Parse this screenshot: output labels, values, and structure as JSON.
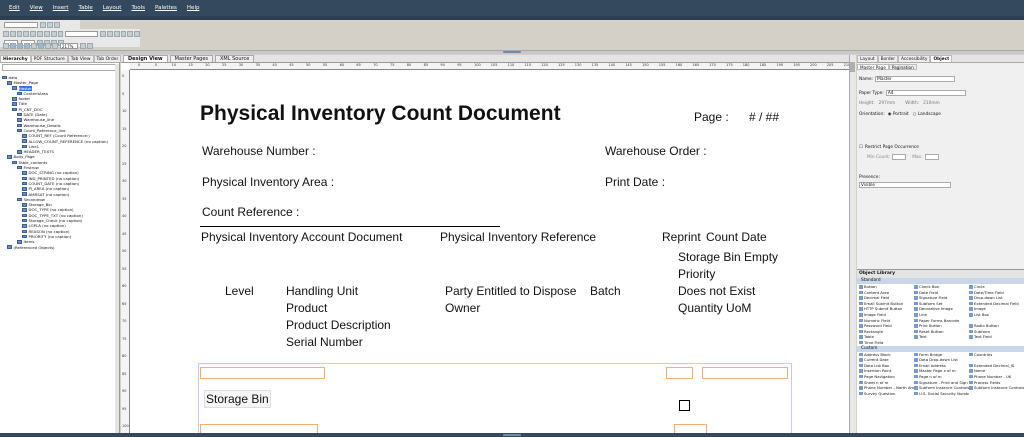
{
  "menu": [
    "Edit",
    "View",
    "Insert",
    "Table",
    "Layout",
    "Tools",
    "Palettes",
    "Help"
  ],
  "toolbar": {
    "zoom": "217%"
  },
  "left_panel": {
    "tabs": [
      "Hierarchy",
      "PDF Structure",
      "Tab View",
      "Tab Order"
    ],
    "tree": [
      {
        "label": "data",
        "indent": 0
      },
      {
        "label": "Master_Page",
        "indent": 1
      },
      {
        "label": "Master",
        "indent": 2,
        "selected": true
      },
      {
        "label": "ContentArea",
        "indent": 3
      },
      {
        "label": "footer",
        "indent": 2
      },
      {
        "label": "Title",
        "indent": 2
      },
      {
        "label": "PI_CNT_DOC",
        "indent": 2
      },
      {
        "label": "DATE (Date)",
        "indent": 3
      },
      {
        "label": "Warehouse_line",
        "indent": 3
      },
      {
        "label": "Warehouse_Details",
        "indent": 3
      },
      {
        "label": "Count_Reference_line",
        "indent": 3
      },
      {
        "label": "COUNT_REF (Count Reference:)",
        "indent": 4
      },
      {
        "label": "ALLOW_COUNT_REFERENCE (no caption)",
        "indent": 4
      },
      {
        "label": "Line1",
        "indent": 4
      },
      {
        "label": "HEADER_TEXTS",
        "indent": 3
      },
      {
        "label": "Body_Page",
        "indent": 1
      },
      {
        "label": "Table_contents",
        "indent": 2
      },
      {
        "label": "Firstrow",
        "indent": 3
      },
      {
        "label": "DOC_STRING (no caption)",
        "indent": 4
      },
      {
        "label": "IND_PRINTED (no caption)",
        "indent": 4
      },
      {
        "label": "COUNT_DATE (no caption)",
        "indent": 4
      },
      {
        "label": "PI_AREA (no caption)",
        "indent": 4
      },
      {
        "label": "AMRSAT (no caption)",
        "indent": 4
      },
      {
        "label": "Secondrow",
        "indent": 3
      },
      {
        "label": "Storage_Bin",
        "indent": 4
      },
      {
        "label": "DOC_TYPE (no caption)",
        "indent": 4
      },
      {
        "label": "DOC_TYPE_TXT (no caption)",
        "indent": 4
      },
      {
        "label": "Storage_Check (no caption)",
        "indent": 4
      },
      {
        "label": "LGPLA (no caption)",
        "indent": 4
      },
      {
        "label": "REASON (no caption)",
        "indent": 4
      },
      {
        "label": "PRIORITY (no caption)",
        "indent": 4
      },
      {
        "label": "Items",
        "indent": 3
      },
      {
        "label": "(Referenced Objects)",
        "indent": 1
      }
    ]
  },
  "center": {
    "tabs": [
      "Design View",
      "Master Pages",
      "XML Source"
    ],
    "ruler_numbers": [
      "0",
      "5",
      "10",
      "15",
      "20",
      "25",
      "30",
      "35",
      "40",
      "45",
      "50",
      "55",
      "60",
      "65",
      "70",
      "75",
      "80",
      "85",
      "90",
      "95",
      "100",
      "105",
      "110",
      "115",
      "120",
      "125",
      "130",
      "135",
      "140",
      "145",
      "150",
      "155",
      "160",
      "165",
      "170",
      "175",
      "180",
      "185",
      "190",
      "195",
      "200",
      "205",
      "210"
    ],
    "vruler_numbers": [
      "0",
      "5",
      "10",
      "15",
      "20",
      "25",
      "30",
      "35",
      "40",
      "45",
      "50",
      "55",
      "60",
      "65",
      "70",
      "75",
      "80",
      "85",
      "90",
      "95",
      "100"
    ],
    "doc": {
      "title": "Physical Inventory Count Document",
      "page_label": "Page :",
      "page_value": "# / ##",
      "warehouse_number": "Warehouse Number :",
      "warehouse_order": "Warehouse Order :",
      "pi_area": "Physical Inventory Area :",
      "print_date": "Print Date :",
      "count_reference": "Count Reference :",
      "h_account_doc": "Physical Inventory Account Document",
      "h_reference": "Physical Inventory Reference",
      "h_reprint": "Reprint",
      "h_count_date": "Count Date",
      "h_bin_empty": "Storage Bin Empty",
      "h_priority": "Priority",
      "h_level": "Level",
      "h_handling_unit": "Handling Unit",
      "h_party": "Party Entitled to Dispose",
      "h_batch": "Batch",
      "h_not_exist": "Does not Exist",
      "h_product": "Product",
      "h_owner": "Owner",
      "h_quantity": "Quantity UoM",
      "h_product_desc": "Product Description",
      "h_serial": "Serial Number",
      "storage_bin": "Storage Bin"
    }
  },
  "right_panel": {
    "tabs": [
      "Layout",
      "Border",
      "Accessibility",
      "Object"
    ],
    "subtabs": [
      "Master Page",
      "Pagination"
    ],
    "name_label": "Name:",
    "name_value": "Master",
    "paper_type_label": "Paper Type:",
    "paper_type_value": "A4",
    "height_label": "Height:",
    "height_value": "297mm",
    "width_label": "Width:",
    "width_value": "210mm",
    "orientation_label": "Orientation:",
    "portrait": "Portrait",
    "landscape": "Landscape",
    "restrict": "Restrict Page Occurrence",
    "min_count": "Min Count:",
    "max": "Max:",
    "presence_label": "Presence:",
    "presence_value": "Visible",
    "object_library": {
      "title": "Object Library",
      "standard_label": "Standard",
      "standard": [
        "Button",
        "Check Box",
        "Circle",
        "Content Area",
        "Date Field",
        "Date/Time Field",
        "Decimal Field",
        "Signature Field",
        "Drop-down List",
        "Email Submit Button",
        "Subform Set",
        "Extended Decimal Field",
        "HTTP Submit Button",
        "Decorative Image",
        "Image",
        "Image Field",
        "Line",
        "List Box",
        "Numeric Field",
        "Paper Forms Barcode",
        "",
        "Password Field",
        "Print Button",
        "Radio Button",
        "Rectangle",
        "Reset Button",
        "Subform",
        "Table",
        "Text",
        "Text Field",
        "Time Field",
        "",
        ""
      ],
      "custom_label": "Custom",
      "custom": [
        "Address Block",
        "Form Bridge",
        "Countries",
        "Current Date",
        "Data Drop-down List",
        "",
        "Data List Box",
        "Email Address",
        "Extended Decimal_IS",
        "Insertion Point",
        "Master Page x of m",
        "Name",
        "Page Navigation",
        "Page n of m",
        "Phone Number - UK",
        "Sheet n of m",
        "Signature - Print and Sign",
        "Process Fields",
        "Phone Number - North America",
        "Subform Instance Controls Add",
        "Subform Instance Controls Ins",
        "Survey Question",
        "U.S. Social Security Number",
        ""
      ]
    }
  }
}
